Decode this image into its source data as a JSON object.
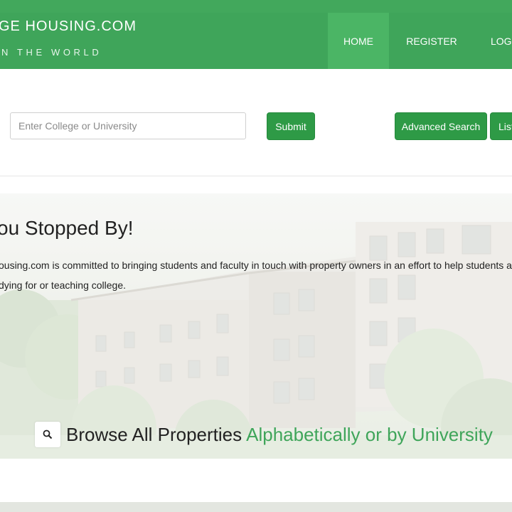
{
  "header": {
    "brand_title": "GE HOUSING.COM",
    "tagline": "N THE WORLD",
    "nav": [
      {
        "label": "HOME"
      },
      {
        "label": "REGISTER"
      },
      {
        "label": "LOGI"
      }
    ]
  },
  "search": {
    "placeholder": "Enter College or University",
    "value": "",
    "submit_label": "Submit",
    "advanced_label": "Advanced Search",
    "list_label": "List"
  },
  "hero": {
    "title": "ou Stopped By!",
    "text_line1": "ousing.com is committed to bringing students and faculty in touch with property owners in an effort to help students a",
    "text_line2": "dying for or teaching college.",
    "browse_label": "Browse All Properties",
    "browse_link": "Alphabetically or by University",
    "search_icon": "search-icon"
  },
  "colors": {
    "brand_green": "#3fa55a",
    "button_green": "#2e9a46",
    "link_green": "#3fa55a"
  }
}
